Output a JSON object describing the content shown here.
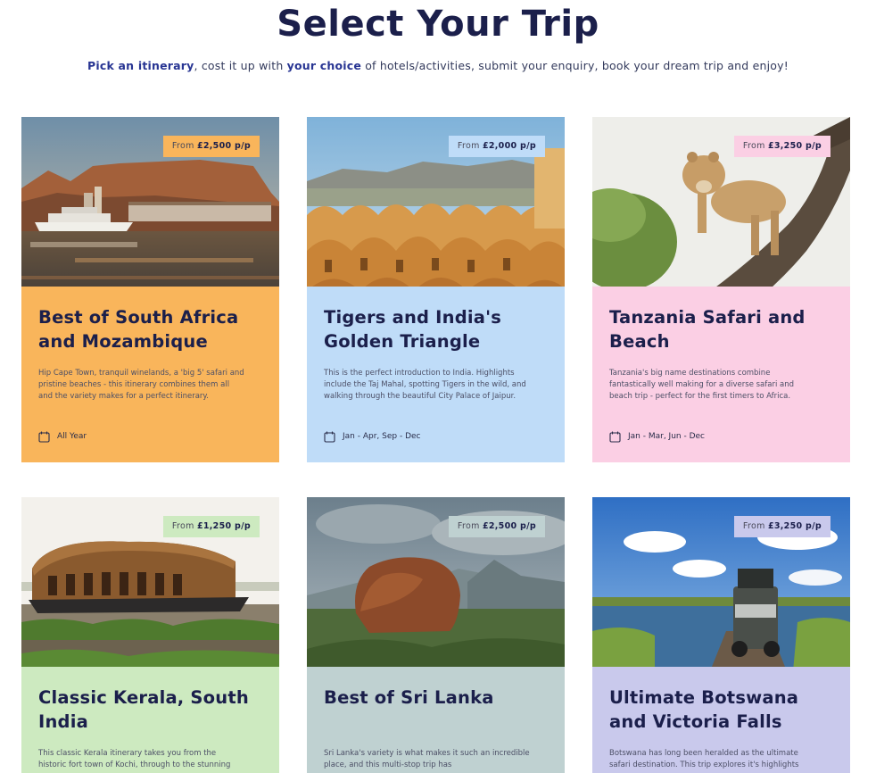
{
  "header": {
    "title": "Select Your Trip",
    "subtitle_hl1": "Pick an itinerary",
    "subtitle_t1": ", cost it up with ",
    "subtitle_hl2": "your choice",
    "subtitle_t2": " of hotels/activities, submit your enquiry, book your dream trip and enjoy!"
  },
  "trips": [
    {
      "price_prefix": "From ",
      "price_value": "£2,500 p/p",
      "title": "Best of South Africa and Mozambique",
      "description": "Hip Cape Town, tranquil winelands, a 'big 5' safari and pristine beaches - this itinerary combines them all and the variety makes for a perfect itinerary.",
      "season": "All Year",
      "colors": {
        "panel": "#f9b55b",
        "price_bg": "#f9b55b"
      }
    },
    {
      "price_prefix": "From ",
      "price_value": "£2,000 p/p",
      "title": "Tigers and India's Golden Triangle",
      "description": "This is the perfect introduction to India. Highlights include the Taj Mahal, spotting Tigers in the wild, and walking through the beautiful City Palace of Jaipur.",
      "season": "Jan - Apr, Sep - Dec",
      "colors": {
        "panel": "#bfdcf8",
        "price_bg": "#bfdcf8"
      }
    },
    {
      "price_prefix": "From ",
      "price_value": "£3,250 p/p",
      "title": "Tanzania Safari and Beach",
      "description": "Tanzania's big name destinations combine fantastically well making for a diverse safari and beach trip - perfect for the first timers to Africa.",
      "season": "Jan - Mar, Jun - Dec",
      "colors": {
        "panel": "#fbcfe4",
        "price_bg": "#fbcfe4"
      }
    },
    {
      "price_prefix": "From ",
      "price_value": "£1,250 p/p",
      "title": "Classic Kerala, South India",
      "description": "This classic Kerala itinerary takes you from the historic fort town of Kochi, through to the stunning",
      "season": "",
      "colors": {
        "panel": "#cdeac0",
        "price_bg": "#cdeac0"
      }
    },
    {
      "price_prefix": "From ",
      "price_value": "£2,500 p/p",
      "title": "Best of Sri Lanka",
      "description": "Sri Lanka's variety is what makes it such an incredible place, and this multi-stop trip has",
      "season": "",
      "colors": {
        "panel": "#bfd1d1",
        "price_bg": "#bfd1d1"
      }
    },
    {
      "price_prefix": "From ",
      "price_value": "£3,250 p/p",
      "title": "Ultimate Botswana and Victoria Falls",
      "description": "Botswana has long been heralded as the ultimate safari destination. This trip explores it's highlights",
      "season": "",
      "colors": {
        "panel": "#c9c9ec",
        "price_bg": "#c9c9ec"
      }
    }
  ],
  "icons": {
    "season": "calendar-icon"
  }
}
